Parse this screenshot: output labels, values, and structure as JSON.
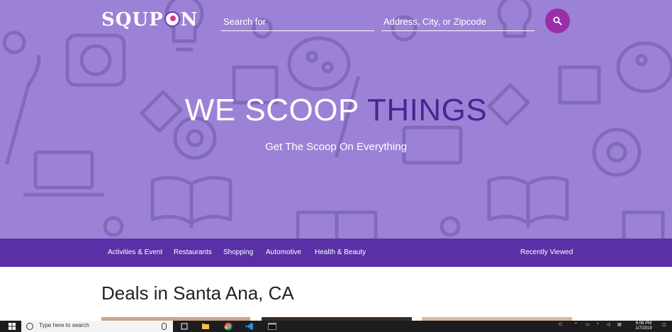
{
  "header": {
    "logo_text_left": "SQUP",
    "logo_text_right": "N",
    "search_placeholder": "Search for",
    "location_placeholder": "Address, City, or Zipcode",
    "search_button_icon": "search-icon"
  },
  "hero": {
    "title_plain": "WE SCOOP ",
    "title_accent": "THINGS",
    "subtitle": "Get The Scoop On Everything"
  },
  "nav": {
    "items": [
      "Activities & Event",
      "Restaurants",
      "Shopping",
      "Automotive",
      "Health & Beauty"
    ],
    "recently_viewed": "Recently Viewed"
  },
  "deals": {
    "heading": "Deals in Santa Ana, CA"
  },
  "taskbar": {
    "search_placeholder": "Type here to search",
    "time": "6:06 PM",
    "date": "1/7/2019"
  },
  "colors": {
    "hero_bg": "#9b82d6",
    "nav_bg": "#5a30a6",
    "accent_text": "#4a2494",
    "search_button": "#9a2ea8"
  }
}
